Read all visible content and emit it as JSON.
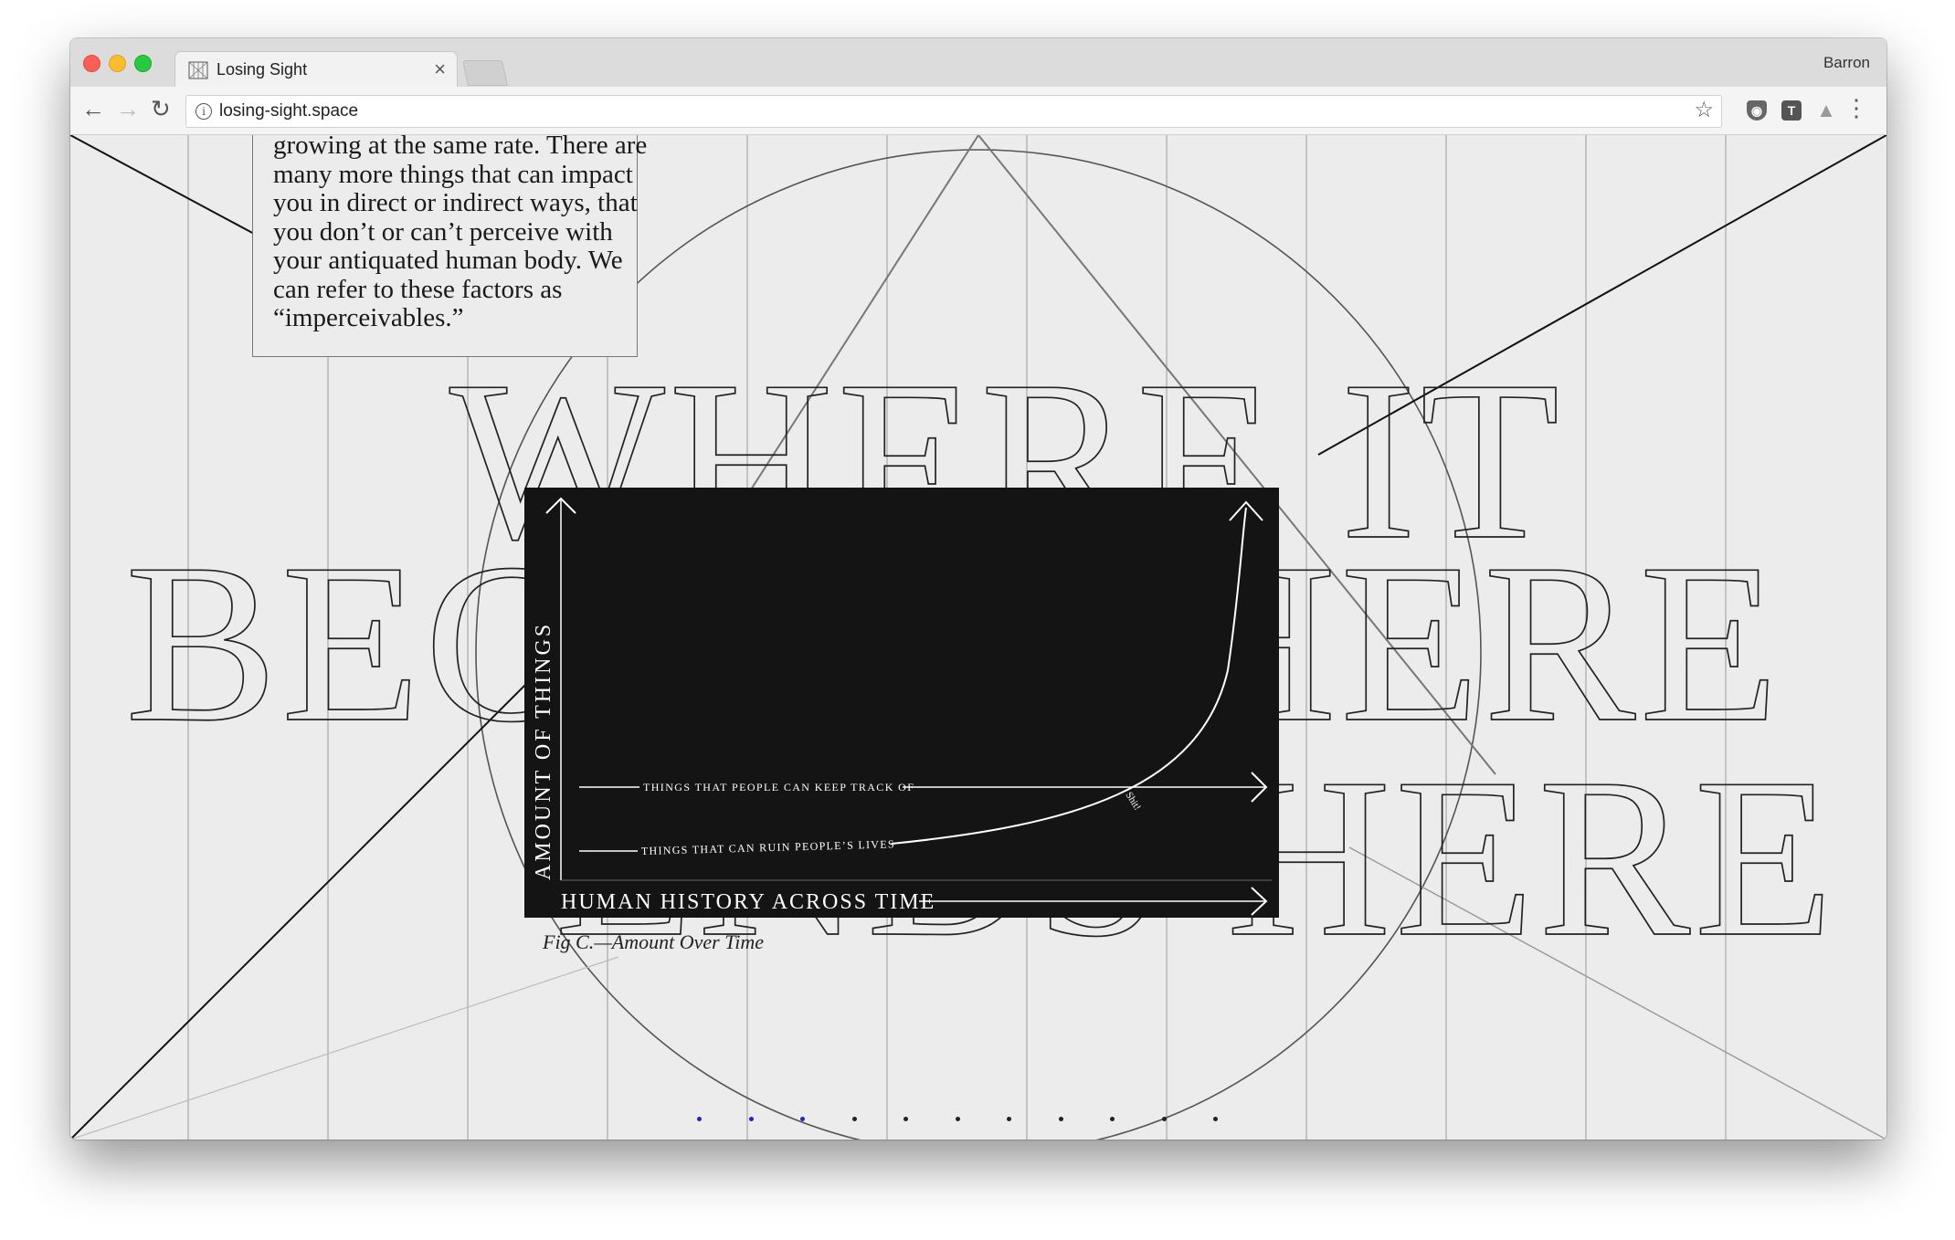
{
  "browser": {
    "tab_title": "Losing Sight",
    "url": "losing-sight.space",
    "profile_name": "Barron"
  },
  "article": {
    "paragraph": "growing at the same rate. There are many more things that can impact you in direct or indirect ways, that you don’t or can’t perceive with your antiquated human body. We can refer to these factors as “imperceivables.”",
    "headline_line1": "WHERE IT",
    "headline_line2": "BEGINS THERE",
    "headline_line3": "ENDS HERE"
  },
  "chart_data": {
    "type": "line",
    "title": "",
    "xlabel": "HUMAN HISTORY ACROSS TIME",
    "ylabel": "AMOUNT OF THINGS",
    "series": [
      {
        "name": "THINGS THAT PEOPLE CAN KEEP TRACK OF",
        "shape": "flat"
      },
      {
        "name": "THINGS THAT CAN RUIN PEOPLE’S LIVES",
        "shape": "exponential"
      }
    ],
    "annotations": [
      "Shit!"
    ],
    "caption": "Fig C.—Amount Over Time"
  },
  "pager": {
    "total": 11,
    "active": 3,
    "active_color": "#2222cc",
    "inactive_color": "#222222"
  }
}
